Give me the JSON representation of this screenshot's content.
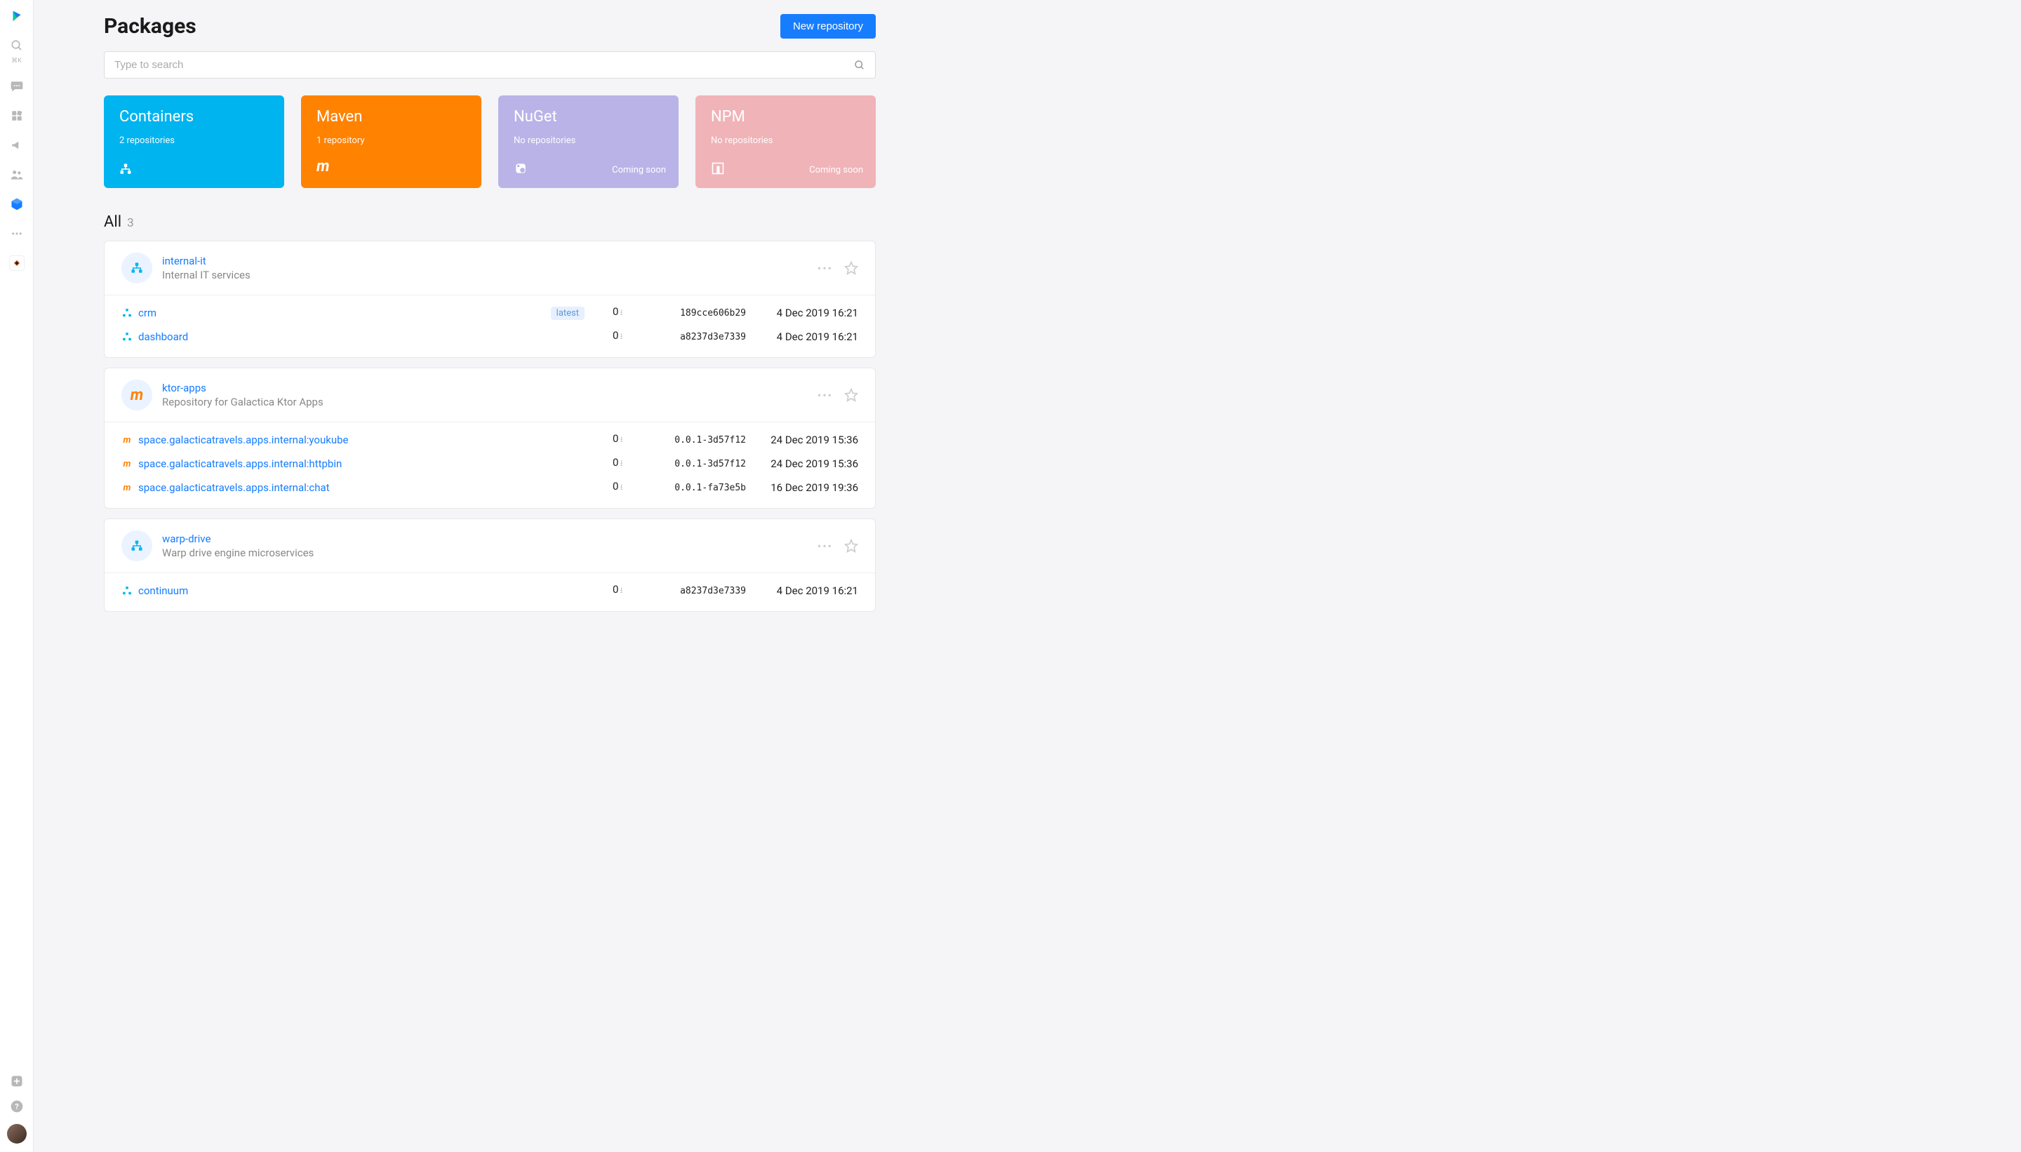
{
  "header": {
    "title": "Packages",
    "new_repo_label": "New repository"
  },
  "search": {
    "placeholder": "Type to search"
  },
  "shortcut": "⌘K",
  "categories": [
    {
      "key": "containers",
      "title": "Containers",
      "sub": "2 repositories",
      "icon_type": "hierarchy",
      "soon": ""
    },
    {
      "key": "maven",
      "title": "Maven",
      "sub": "1 repository",
      "icon_type": "m",
      "soon": ""
    },
    {
      "key": "nuget",
      "title": "NuGet",
      "sub": "No repositories",
      "icon_type": "nuget",
      "soon": "Coming soon"
    },
    {
      "key": "npm",
      "title": "NPM",
      "sub": "No repositories",
      "icon_type": "npm",
      "soon": "Coming soon"
    }
  ],
  "section": {
    "title": "All",
    "count": "3"
  },
  "repos": [
    {
      "type": "containers",
      "name": "internal-it",
      "desc": "Internal IT services",
      "packages": [
        {
          "type": "containers",
          "name": "crm",
          "tag": "latest",
          "downloads": "0",
          "version": "189cce606b29",
          "date": "4 Dec 2019 16:21"
        },
        {
          "type": "containers",
          "name": "dashboard",
          "tag": "",
          "downloads": "0",
          "version": "a8237d3e7339",
          "date": "4 Dec 2019 16:21"
        }
      ]
    },
    {
      "type": "maven",
      "name": "ktor-apps",
      "desc": "Repository for Galactica Ktor Apps",
      "packages": [
        {
          "type": "maven",
          "name": "space.galacticatravels.apps.internal:youkube",
          "tag": "",
          "downloads": "0",
          "version": "0.0.1-3d57f12",
          "date": "24 Dec 2019 15:36"
        },
        {
          "type": "maven",
          "name": "space.galacticatravels.apps.internal:httpbin",
          "tag": "",
          "downloads": "0",
          "version": "0.0.1-3d57f12",
          "date": "24 Dec 2019 15:36"
        },
        {
          "type": "maven",
          "name": "space.galacticatravels.apps.internal:chat",
          "tag": "",
          "downloads": "0",
          "version": "0.0.1-fa73e5b",
          "date": "16 Dec 2019 19:36"
        }
      ]
    },
    {
      "type": "containers",
      "name": "warp-drive",
      "desc": "Warp drive engine microservices",
      "packages": [
        {
          "type": "containers",
          "name": "continuum",
          "tag": "",
          "downloads": "0",
          "version": "a8237d3e7339",
          "date": "4 Dec 2019 16:21"
        }
      ]
    }
  ]
}
